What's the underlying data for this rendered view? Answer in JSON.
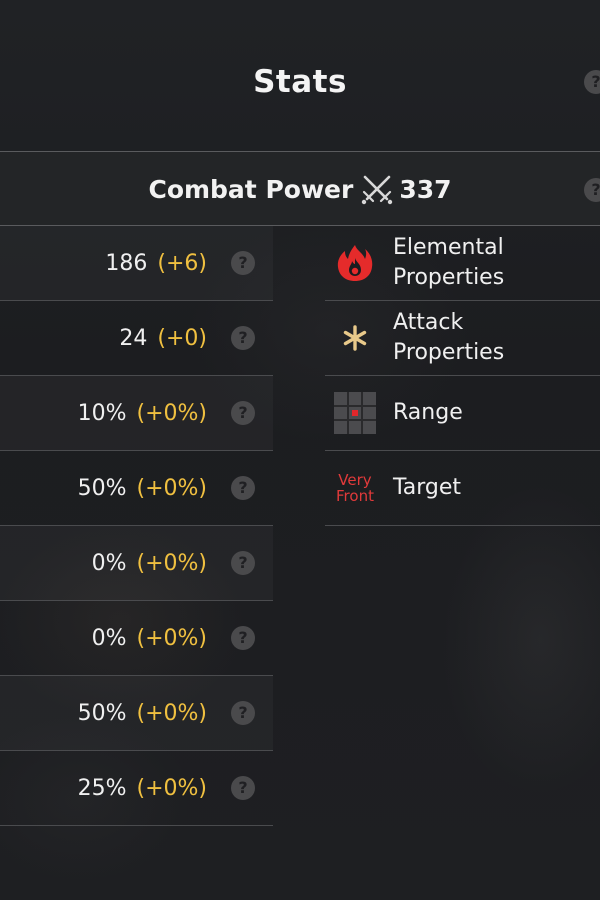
{
  "header": {
    "title": "Stats",
    "help_glyph": "?"
  },
  "combat_power": {
    "label": "Combat Power",
    "icon": "crossed-swords-icon",
    "value": "337"
  },
  "stats": [
    {
      "value": "186",
      "bonus": "(+6)"
    },
    {
      "value": "24",
      "bonus": "(+0)"
    },
    {
      "value": "10%",
      "bonus": "(+0%)"
    },
    {
      "value": "50%",
      "bonus": "(+0%)"
    },
    {
      "value": "0%",
      "bonus": "(+0%)"
    },
    {
      "value": "0%",
      "bonus": "(+0%)"
    },
    {
      "value": "50%",
      "bonus": "(+0%)"
    },
    {
      "value": "25%",
      "bonus": "(+0%)"
    }
  ],
  "properties": {
    "elemental": {
      "label_line1": "Elemental",
      "label_line2": "Properties",
      "icon": "fire-element-icon"
    },
    "attack": {
      "label_line1": "Attack",
      "label_line2": "Properties",
      "icon": "star-burst-icon"
    },
    "range": {
      "label": "Range",
      "icon": "range-grid-icon"
    },
    "target": {
      "label": "Target",
      "badge_line1": "Very",
      "badge_line2": "Front"
    }
  },
  "colors": {
    "bonus": "#f0c040",
    "fire": "#e52b2b",
    "accent_red": "#e03a3a",
    "star": "#e8c98a"
  }
}
